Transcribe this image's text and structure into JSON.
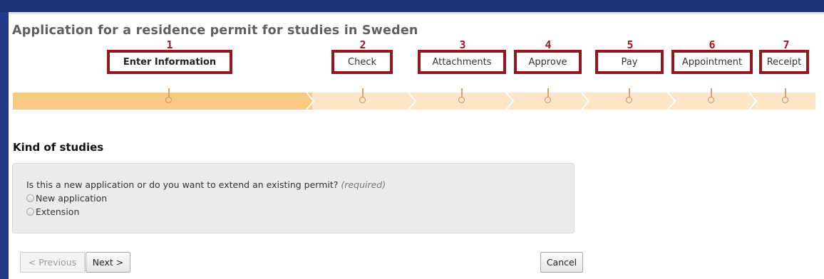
{
  "page": {
    "title": "Application for a residence permit for studies in Sweden"
  },
  "steps": [
    {
      "number": "1",
      "label": "Enter Information",
      "active": true
    },
    {
      "number": "2",
      "label": "Check",
      "active": false
    },
    {
      "number": "3",
      "label": "Attachments",
      "active": false
    },
    {
      "number": "4",
      "label": "Approve",
      "active": false
    },
    {
      "number": "5",
      "label": "Pay",
      "active": false
    },
    {
      "number": "6",
      "label": "Appointment",
      "active": false
    },
    {
      "number": "7",
      "label": "Receipt",
      "active": false
    }
  ],
  "section": {
    "heading": "Kind of studies"
  },
  "question": {
    "text": "Is this a new application or do you want to extend an existing permit?",
    "required_label": "(required)",
    "options": [
      {
        "label": "New application",
        "selected": false
      },
      {
        "label": "Extension",
        "selected": false
      }
    ]
  },
  "buttons": {
    "previous": "< Previous",
    "next": "Next >",
    "cancel": "Cancel"
  },
  "colors": {
    "background": "#233a8a",
    "annotation": "#961620",
    "progress_fill": "#fac983",
    "progress_track": "#fde6c8"
  }
}
